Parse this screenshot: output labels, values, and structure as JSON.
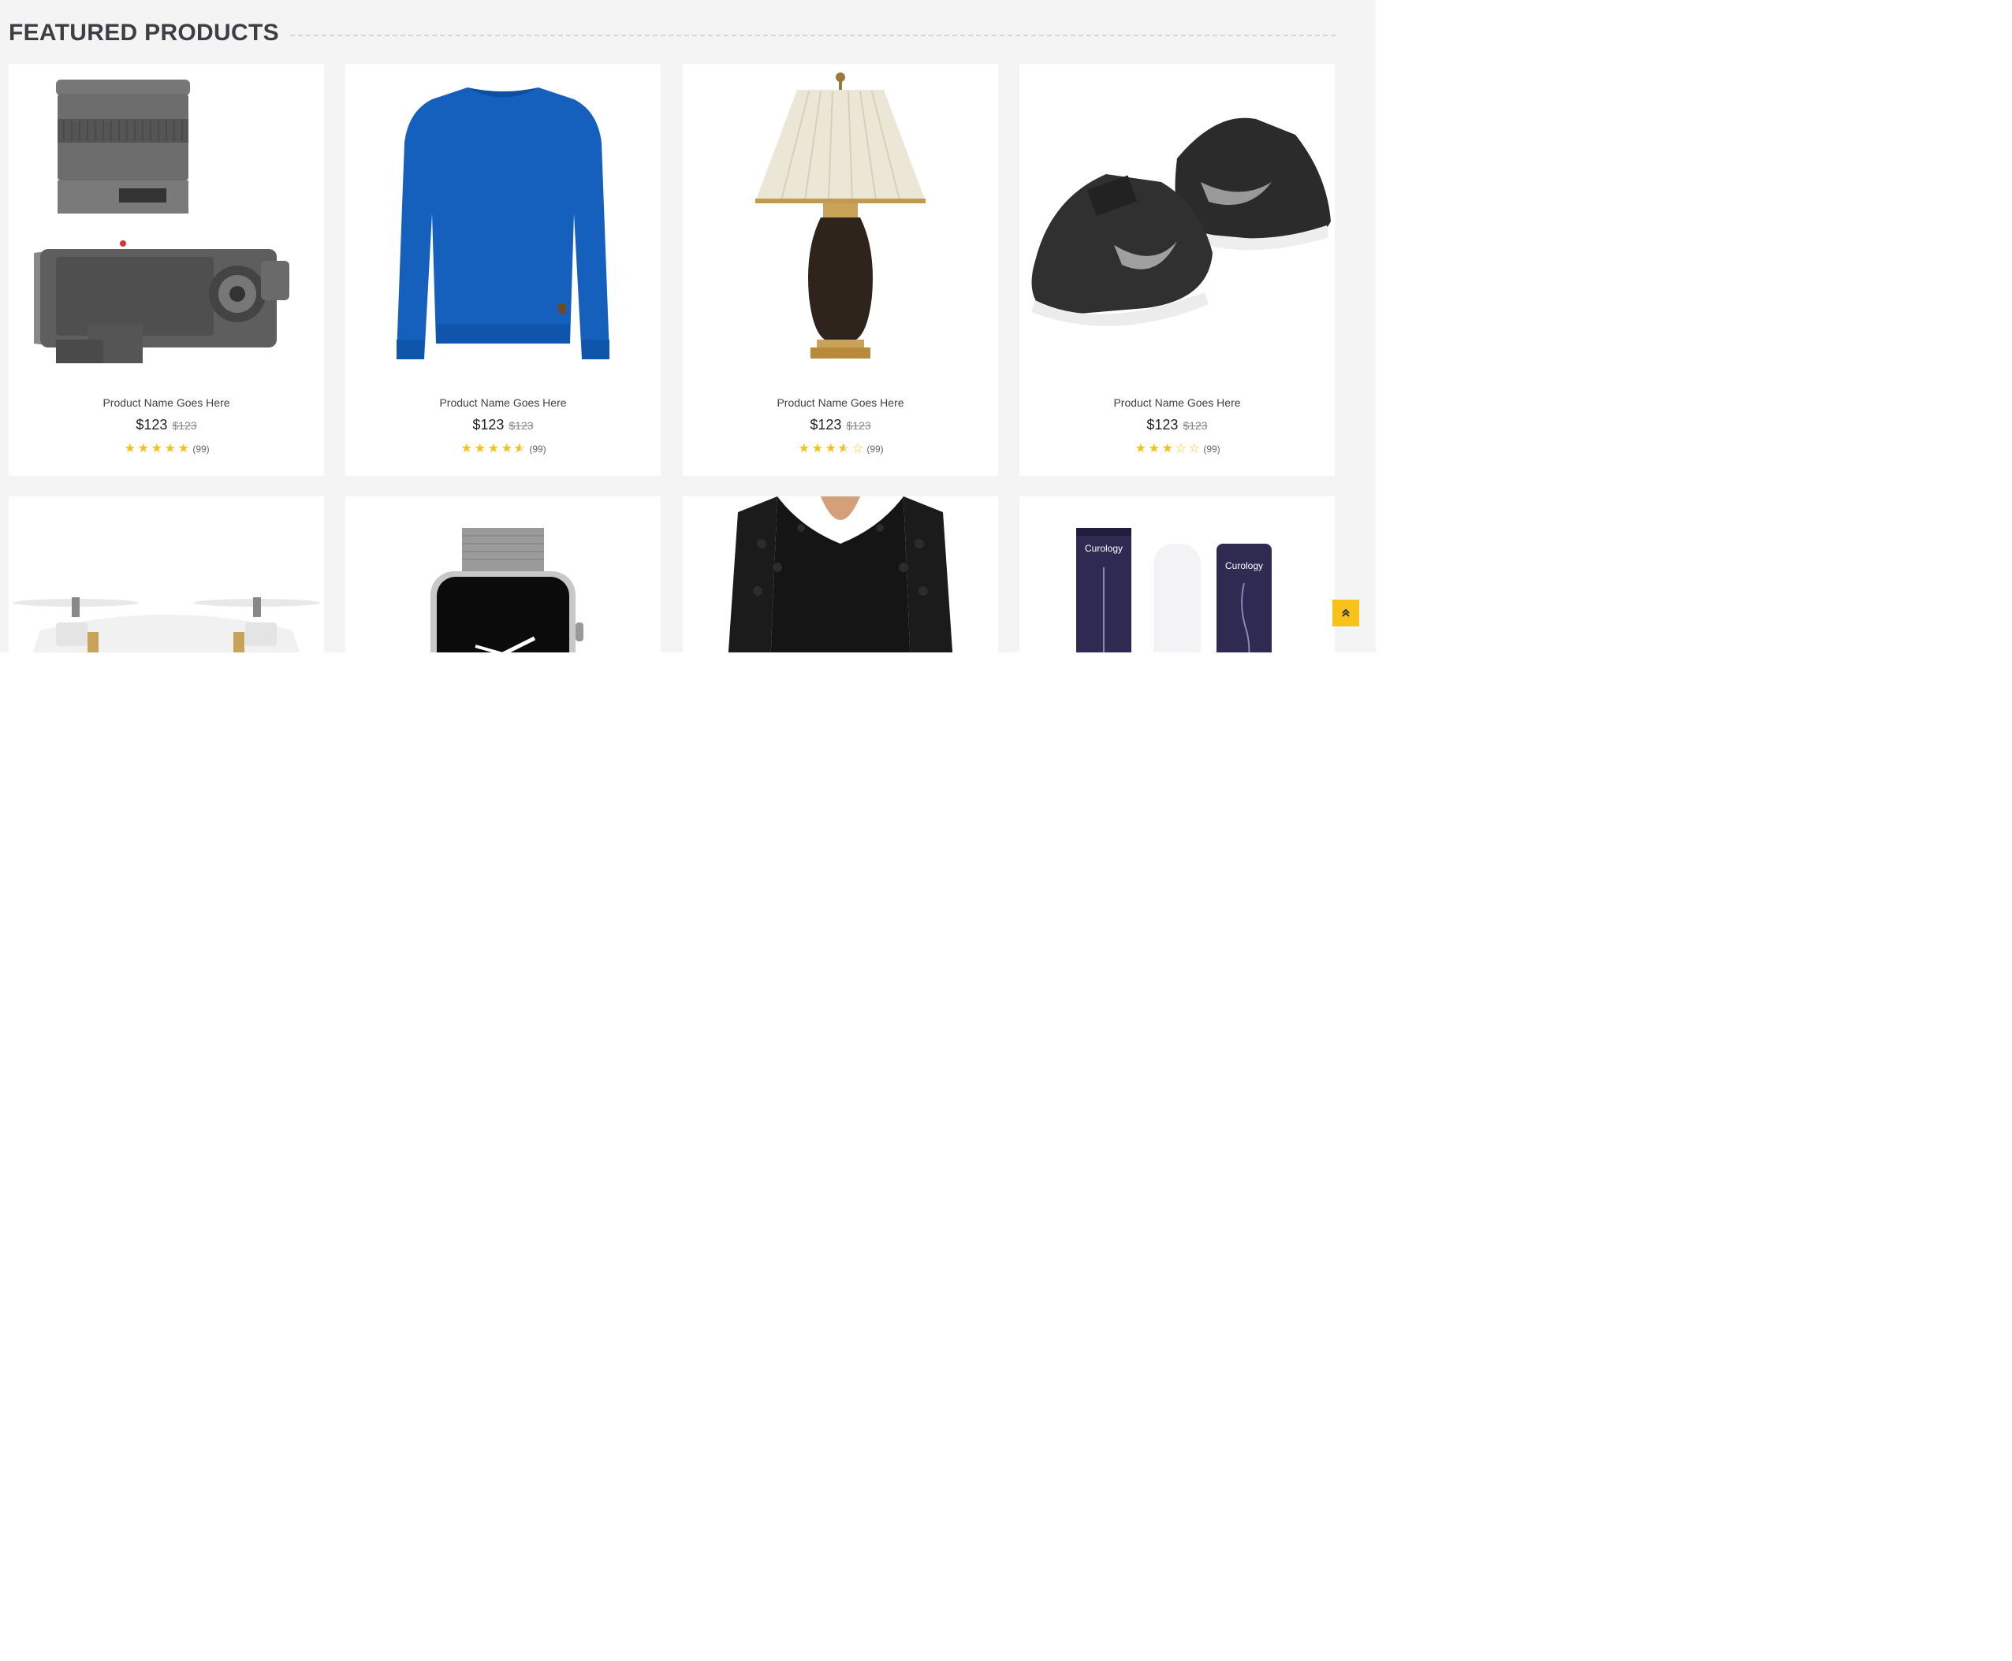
{
  "section": {
    "title": "FEATURED PRODUCTS"
  },
  "colors": {
    "accent": "#f7c21a",
    "star": "#f5c218",
    "page_bg": "#f4f4f4",
    "card_bg": "#ffffff"
  },
  "products": [
    {
      "name": "Product Name Goes Here",
      "price": "$123",
      "old_price": "$123",
      "rating": 5,
      "reviews": "(99)",
      "image": "camera"
    },
    {
      "name": "Product Name Goes Here",
      "price": "$123",
      "old_price": "$123",
      "rating": 4.5,
      "reviews": "(99)",
      "image": "blue-sweater"
    },
    {
      "name": "Product Name Goes Here",
      "price": "$123",
      "old_price": "$123",
      "rating": 3.5,
      "reviews": "(99)",
      "image": "table-lamp"
    },
    {
      "name": "Product Name Goes Here",
      "price": "$123",
      "old_price": "$123",
      "rating": 3,
      "reviews": "(99)",
      "image": "sneakers"
    },
    {
      "image": "drone"
    },
    {
      "image": "smartwatch"
    },
    {
      "image": "black-lace-dress"
    },
    {
      "image": "skincare-tubes",
      "brand_text": "Curology"
    }
  ],
  "scroll_top": {
    "icon": "double-chevron-up-icon"
  }
}
